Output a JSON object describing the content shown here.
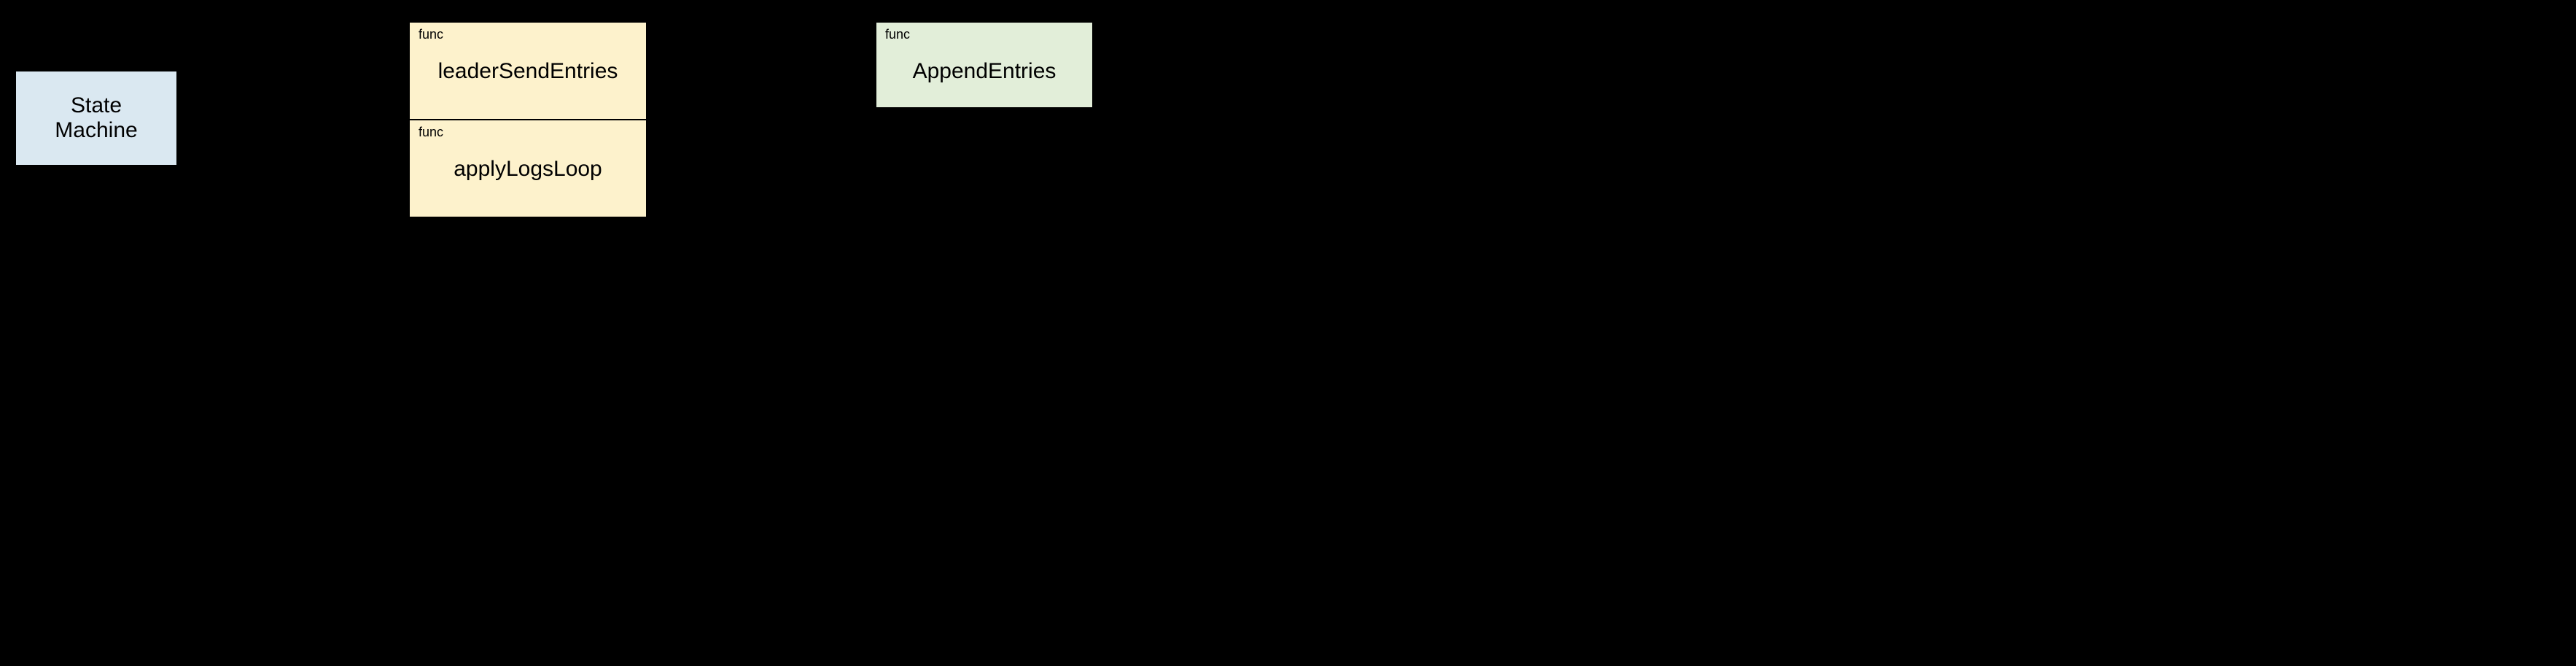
{
  "boxes": {
    "state_machine": "State\nMachine",
    "leader_send_entries": {
      "tag": "func",
      "name": "leaderSendEntries"
    },
    "apply_logs_loop": {
      "tag": "func",
      "name": "applyLogsLoop"
    },
    "append_entries": {
      "tag": "func",
      "name": "AppendEntries"
    }
  }
}
